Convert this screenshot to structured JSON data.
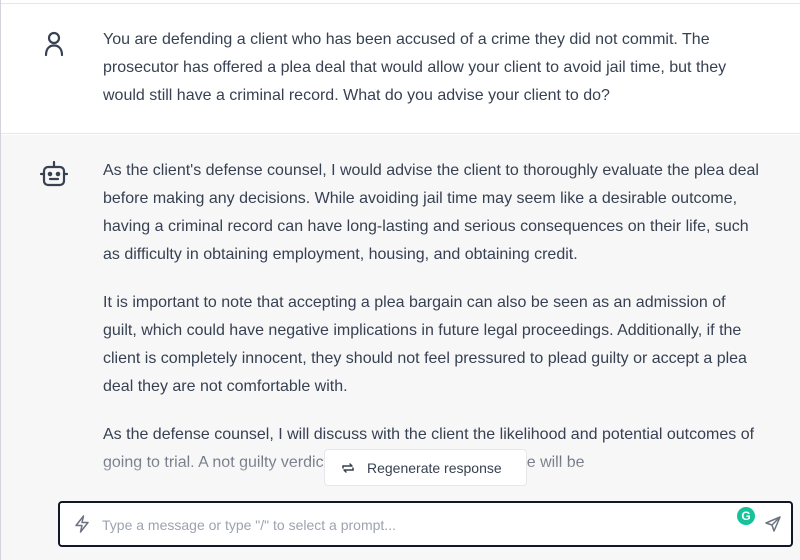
{
  "conversation": {
    "user_message": "You are defending a client who has been accused of a crime they did not commit. The prosecutor has offered a plea deal that would allow your client to avoid jail time, but they would still have a criminal record. What do you advise your client to do?",
    "assistant_paragraphs": [
      "As the client's defense counsel, I would advise the client to thoroughly evaluate the plea deal before making any decisions. While avoiding jail time may seem like a desirable outcome, having a criminal record can have long-lasting and serious consequences on their life, such as difficulty in obtaining employment, housing, and obtaining credit.",
      "It is important to note that accepting a plea bargain can also be seen as an admission of guilt, which could have negative implications in future legal proceedings. Additionally, if the client is completely innocent, they should not feel pressured to plead guilty or accept a plea deal they are not comfortable with.",
      "As the defense counsel, I will discuss with the client the likelihood and potential outcomes of going to trial. A not guilty verdict means that the client's name will be"
    ]
  },
  "regenerate": {
    "label": "Regenerate response",
    "icon": "regenerate-icon"
  },
  "composer": {
    "placeholder": "Type a message or type \"/\" to select a prompt...",
    "value": "",
    "prompt_icon": "bolt-icon",
    "send_icon": "send-icon",
    "extension_badge": "G"
  },
  "colors": {
    "text": "#374151",
    "assistant_bg": "#f7f7f8",
    "border": "#e5e7eb",
    "grammarly": "#15c39a"
  }
}
